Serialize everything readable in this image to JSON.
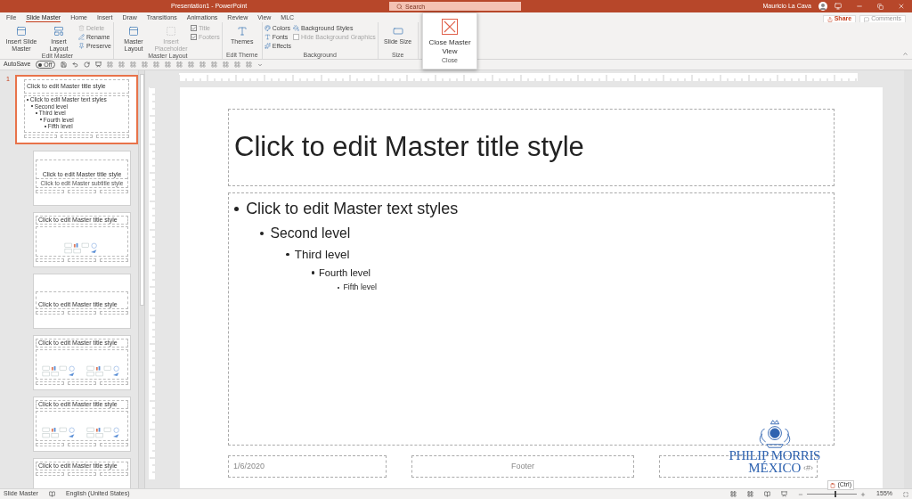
{
  "window": {
    "title": "Presentation1 - PowerPoint",
    "user": "Mauricio La Cava"
  },
  "search": {
    "placeholder": "Search"
  },
  "tabs": [
    {
      "label": "File",
      "selected": false
    },
    {
      "label": "Slide Master",
      "selected": true
    },
    {
      "label": "Home",
      "selected": false
    },
    {
      "label": "Insert",
      "selected": false
    },
    {
      "label": "Draw",
      "selected": false
    },
    {
      "label": "Transitions",
      "selected": false
    },
    {
      "label": "Animations",
      "selected": false
    },
    {
      "label": "Review",
      "selected": false
    },
    {
      "label": "View",
      "selected": false
    },
    {
      "label": "MLC",
      "selected": false
    }
  ],
  "share": "Share",
  "comments": "Comments",
  "ribbon": {
    "groups": [
      {
        "label": "Edit Master",
        "columns": [
          [
            {
              "kind": "large",
              "label": "Insert Slide Master",
              "disabled": false
            }
          ],
          [
            {
              "kind": "large",
              "label": "Insert Layout",
              "disabled": false
            }
          ],
          [
            {
              "kind": "small",
              "label": "Delete",
              "disabled": true
            },
            {
              "kind": "small",
              "label": "Rename",
              "disabled": false
            },
            {
              "kind": "small",
              "label": "Preserve",
              "disabled": false
            }
          ]
        ]
      },
      {
        "label": "Master Layout",
        "columns": [
          [
            {
              "kind": "large",
              "label": "Master Layout",
              "disabled": false
            }
          ],
          [
            {
              "kind": "large",
              "label": "Insert Placeholder",
              "disabled": true
            }
          ],
          [
            {
              "kind": "check",
              "label": "Title",
              "checked": true,
              "disabled": true
            },
            {
              "kind": "check",
              "label": "Footers",
              "checked": true,
              "disabled": true
            }
          ]
        ]
      },
      {
        "label": "Edit Theme",
        "columns": [
          [
            {
              "kind": "large",
              "label": "Themes",
              "disabled": false
            }
          ]
        ]
      },
      {
        "label": "Background",
        "columns": [
          [
            {
              "kind": "small",
              "label": "Colors",
              "disabled": false
            },
            {
              "kind": "small",
              "label": "Fonts",
              "disabled": false
            },
            {
              "kind": "small",
              "label": "Effects",
              "disabled": false
            }
          ],
          [
            {
              "kind": "small",
              "label": "Background Styles",
              "disabled": false
            },
            {
              "kind": "check",
              "label": "Hide Background Graphics",
              "checked": false,
              "disabled": true
            }
          ]
        ]
      },
      {
        "label": "Size",
        "columns": [
          [
            {
              "kind": "large",
              "label": "Slide Size",
              "disabled": false
            }
          ]
        ]
      }
    ]
  },
  "close_popup": {
    "label": "Close Master View",
    "group": "Close"
  },
  "quick_access": {
    "autosave": "AutoSave",
    "toggle": "Off",
    "on": false
  },
  "thumbnails": [
    {
      "kind": "master",
      "selected": true,
      "number": "1",
      "title": "Click to edit Master title style",
      "lines": [
        {
          "text": "Click to edit Master text styles",
          "children": [
            {
              "text": "Second level",
              "children": [
                {
                  "text": "Third level",
                  "children": [
                    {
                      "text": "Fourth level",
                      "children": [
                        {
                          "text": "Fifth level"
                        }
                      ]
                    }
                  ]
                }
              ]
            }
          ]
        }
      ]
    },
    {
      "kind": "title",
      "selected": false,
      "title": "Click to edit Master title style",
      "subtitle": "Click to edit Master subtitle style"
    },
    {
      "kind": "content",
      "selected": false,
      "title": "Click to edit Master title style"
    },
    {
      "kind": "section",
      "selected": false,
      "title": "Click to edit Master title style"
    },
    {
      "kind": "two",
      "selected": false,
      "title": "Click to edit Master title style"
    },
    {
      "kind": "compare",
      "selected": false,
      "title": "Click to edit Master title style"
    },
    {
      "kind": "titleonly",
      "selected": false,
      "title": "Click to edit Master title style"
    }
  ],
  "slide": {
    "title": "Click to edit Master title style",
    "body": [
      {
        "text": "Click to edit Master text styles",
        "children": [
          {
            "text": "Second level",
            "children": [
              {
                "text": "Third level",
                "children": [
                  {
                    "text": "Fourth level",
                    "children": [
                      {
                        "text": "Fifth level"
                      }
                    ]
                  }
                ]
              }
            ]
          }
        ]
      }
    ],
    "date": "1/6/2020",
    "footer": "Footer",
    "number": "‹#›",
    "logo": [
      "PHILIP MORRIS",
      "MÉXICO"
    ],
    "paste": "(Ctrl)"
  },
  "status_bar": {
    "view": "Slide Master",
    "language": "English (United States)",
    "zoom": "155%",
    "level": 0.55
  }
}
